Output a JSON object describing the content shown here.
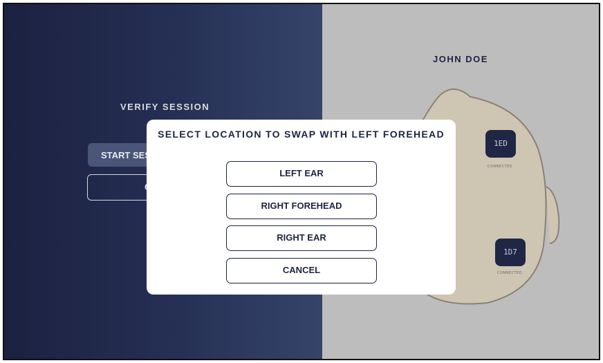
{
  "background_panel": {
    "verify_title": "VERIFY SESSION",
    "start_button_label": "START SESSION",
    "outline_button_label": "CANCEL"
  },
  "patient": {
    "name": "JOHN DOE"
  },
  "sensors": [
    {
      "id": "1ED",
      "status": "CONNECTED"
    },
    {
      "id": "1D7",
      "status": "CONNECTED"
    }
  ],
  "modal": {
    "title": "SELECT LOCATION TO SWAP WITH LEFT FOREHEAD",
    "options": [
      "LEFT EAR",
      "RIGHT FOREHEAD",
      "RIGHT EAR",
      "CANCEL"
    ]
  },
  "colors": {
    "navy": "#1e2440",
    "panel_gradient_start": "#1b2140",
    "panel_gradient_end": "#36446a",
    "right_panel": "#bdbdbd",
    "head_fill": "#cfc5b3"
  }
}
